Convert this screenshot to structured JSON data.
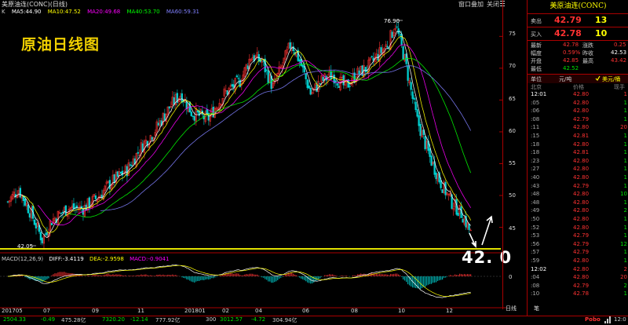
{
  "window": {
    "title": "美原油连(CONC)(日线)",
    "tab_labels": [
      "窗口叠加",
      "关闭"
    ],
    "menu_icon": "list-icon"
  },
  "indicators": {
    "k_label": "K",
    "ma": [
      {
        "label": "MA5:44.90",
        "color": "#ffffff"
      },
      {
        "label": "MA10:47.52",
        "color": "#ffff00"
      },
      {
        "label": "MA20:49.68",
        "color": "#ff00ff"
      },
      {
        "label": "MA40:53.70",
        "color": "#00ff00"
      },
      {
        "label": "MA60:59.31",
        "color": "#8080ff"
      }
    ]
  },
  "overlay": {
    "title": "原油日线图",
    "high_label": "76.90",
    "low_label": "42.05",
    "annotation": "42. 0"
  },
  "macd": {
    "labels": [
      {
        "text": "MACD(12,26,9)",
        "color": "#cccccc"
      },
      {
        "text": "DIFF:-3.4119",
        "color": "#ffffff"
      },
      {
        "text": "DEA:-2.9598",
        "color": "#ffff00"
      },
      {
        "text": "MACD:-0.9041",
        "color": "#ff00ff"
      }
    ],
    "zero_label": "0"
  },
  "x_axis": [
    "201705",
    "07",
    "09",
    "11",
    "201801",
    "02",
    "04",
    "06",
    "08",
    "10",
    "12"
  ],
  "y_axis": [
    "75",
    "70",
    "65",
    "60",
    "55",
    "50",
    "45"
  ],
  "quote": {
    "title": "美原油连(CONC)",
    "sell": {
      "label": "卖出",
      "price": "42.79",
      "volume": "13"
    },
    "buy": {
      "label": "买入",
      "price": "42.78",
      "volume": "10"
    },
    "stats": [
      {
        "l1": "最新",
        "v1": "42.78",
        "l2": "涨跌",
        "v2": "0.25"
      },
      {
        "l1": "幅度",
        "v1": "0.59%",
        "l2": "昨收",
        "v2": "42.53"
      },
      {
        "l1": "开盘",
        "v1": "42.85",
        "l2": "最高",
        "v2": "43.42"
      },
      {
        "l1": "最低",
        "v1": "42.52",
        "l2": "",
        "v2": ""
      }
    ],
    "unit": {
      "label": "单位",
      "value": "元/吨",
      "currency": "美元/桶"
    },
    "header": {
      "c1": "北京",
      "c2": "价格",
      "c3": "现手"
    },
    "ticks": [
      {
        "t": "12:01",
        "p": "42.80",
        "v": "1",
        "pc": "red",
        "vc": "red"
      },
      {
        "t": ":05",
        "p": "42.80",
        "v": "1",
        "pc": "red",
        "vc": "green"
      },
      {
        "t": ":06",
        "p": "42.80",
        "v": "1",
        "pc": "red",
        "vc": "green"
      },
      {
        "t": ":08",
        "p": "42.79",
        "v": "1",
        "pc": "red",
        "vc": "green"
      },
      {
        "t": ":11",
        "p": "42.80",
        "v": "20",
        "pc": "red",
        "vc": "red"
      },
      {
        "t": ":15",
        "p": "42.81",
        "v": "1",
        "pc": "red",
        "vc": "green"
      },
      {
        "t": ":18",
        "p": "42.80",
        "v": "1",
        "pc": "red",
        "vc": "green"
      },
      {
        "t": ":18",
        "p": "42.81",
        "v": "1",
        "pc": "red",
        "vc": "green"
      },
      {
        "t": ":23",
        "p": "42.80",
        "v": "1",
        "pc": "red",
        "vc": "green"
      },
      {
        "t": ":27",
        "p": "42.80",
        "v": "1",
        "pc": "red",
        "vc": "green"
      },
      {
        "t": ":40",
        "p": "42.80",
        "v": "1",
        "pc": "red",
        "vc": "green"
      },
      {
        "t": ":43",
        "p": "42.79",
        "v": "1",
        "pc": "red",
        "vc": "green"
      },
      {
        "t": ":48",
        "p": "42.80",
        "v": "10",
        "pc": "red",
        "vc": "green"
      },
      {
        "t": ":48",
        "p": "42.80",
        "v": "1",
        "pc": "red",
        "vc": "green"
      },
      {
        "t": ":49",
        "p": "42.80",
        "v": "2",
        "pc": "red",
        "vc": "green"
      },
      {
        "t": ":50",
        "p": "42.80",
        "v": "1",
        "pc": "red",
        "vc": "green"
      },
      {
        "t": ":52",
        "p": "42.80",
        "v": "1",
        "pc": "red",
        "vc": "green"
      },
      {
        "t": ":53",
        "p": "42.79",
        "v": "1",
        "pc": "red",
        "vc": "green"
      },
      {
        "t": ":56",
        "p": "42.79",
        "v": "12",
        "pc": "red",
        "vc": "green"
      },
      {
        "t": ":57",
        "p": "42.79",
        "v": "1",
        "pc": "red",
        "vc": "green"
      },
      {
        "t": ":59",
        "p": "42.80",
        "v": "1",
        "pc": "red",
        "vc": "green"
      },
      {
        "t": "12:02",
        "p": "42.80",
        "v": "2",
        "pc": "red",
        "vc": "red"
      },
      {
        "t": ":04",
        "p": "42.80",
        "v": "20",
        "pc": "red",
        "vc": "red"
      },
      {
        "t": ":08",
        "p": "42.79",
        "v": "2",
        "pc": "red",
        "vc": "green"
      },
      {
        "t": ":10",
        "p": "42.78",
        "v": "1",
        "pc": "red",
        "vc": "green"
      }
    ],
    "bottom_tabs": [
      "日线",
      "笔"
    ]
  },
  "status": {
    "items": [
      {
        "text": "2504.33",
        "color": "#00e000"
      },
      {
        "text": "-0.49",
        "color": "#00e000"
      },
      {
        "text": "475.28亿",
        "color": "#cccccc"
      },
      {
        "text": "7320.20",
        "color": "#00e000"
      },
      {
        "text": "-12.14",
        "color": "#00e000"
      },
      {
        "text": "777.92亿",
        "color": "#cccccc"
      },
      {
        "text": "300",
        "color": "#cccccc"
      },
      {
        "text": "3012.57",
        "color": "#00e000"
      },
      {
        "text": "-4.72",
        "color": "#00e000"
      },
      {
        "text": "304.94亿",
        "color": "#cccccc"
      }
    ],
    "brand": "Pobo",
    "clock": "12:0"
  },
  "colors": {
    "up": "#ff3232",
    "down": "#00d0d0",
    "frame": "#aa0000",
    "support_line": "#ffff00"
  }
}
